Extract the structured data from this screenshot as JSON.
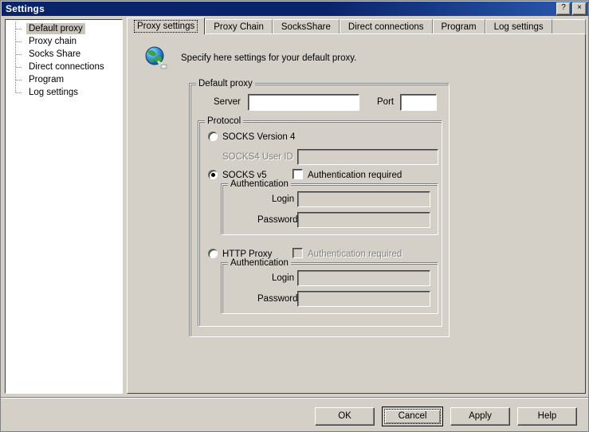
{
  "window": {
    "title": "Settings",
    "help_button": "?",
    "close_button": "×"
  },
  "sidebar": {
    "items": [
      {
        "label": "Default proxy",
        "selected": true
      },
      {
        "label": "Proxy chain",
        "selected": false
      },
      {
        "label": "Socks Share",
        "selected": false
      },
      {
        "label": "Direct connections",
        "selected": false
      },
      {
        "label": "Program",
        "selected": false
      },
      {
        "label": "Log settings",
        "selected": false
      }
    ]
  },
  "tabs": [
    {
      "label": "Proxy settings",
      "active": true
    },
    {
      "label": "Proxy Chain",
      "active": false
    },
    {
      "label": "SocksShare",
      "active": false
    },
    {
      "label": "Direct connections",
      "active": false
    },
    {
      "label": "Program",
      "active": false
    },
    {
      "label": "Log settings",
      "active": false
    }
  ],
  "page": {
    "header_text": "Specify here settings for your default proxy.",
    "icon": "globe-network-icon"
  },
  "default_proxy": {
    "group_title": "Default proxy",
    "server_label": "Server",
    "server_value": "",
    "port_label": "Port",
    "port_value": ""
  },
  "protocol": {
    "group_title": "Protocol",
    "socks4": {
      "radio_label": "SOCKS Version 4",
      "selected": false,
      "userid_label": "SOCKS4 User ID",
      "userid_value": "",
      "userid_disabled": true
    },
    "socks5": {
      "radio_label": "SOCKS v5",
      "selected": true,
      "auth_required_label": "Authentication required",
      "auth_required_checked": false,
      "auth_required_disabled": false,
      "auth_group_title": "Authentication",
      "login_label": "Login",
      "login_value": "",
      "password_label": "Password",
      "password_value": ""
    },
    "http": {
      "radio_label": "HTTP Proxy",
      "selected": false,
      "auth_required_label": "Authentication required",
      "auth_required_checked": false,
      "auth_required_disabled": true,
      "auth_group_title": "Authentication",
      "login_label": "Login",
      "login_value": "",
      "password_label": "Password",
      "password_value": ""
    }
  },
  "buttons": {
    "ok": "OK",
    "cancel": "Cancel",
    "apply": "Apply",
    "help": "Help"
  },
  "colors": {
    "face": "#d4d0c8",
    "title_start": "#0a246a",
    "title_end": "#2a5ab0",
    "selection": "#c8c4bc",
    "disabled_text": "#808080"
  }
}
